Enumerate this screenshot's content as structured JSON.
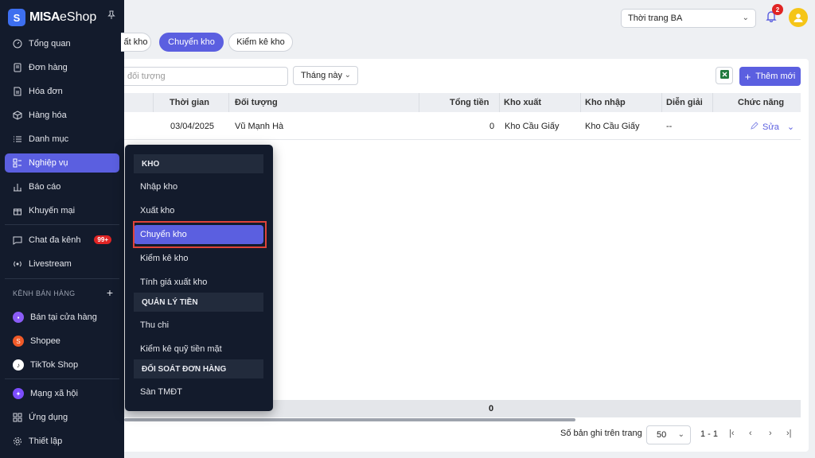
{
  "brand": {
    "logo_bold": "MISA",
    "logo_light": "eShop",
    "logo_letter": "S"
  },
  "sidebar": {
    "items": [
      {
        "label": "Tổng quan",
        "icon": "gauge-icon"
      },
      {
        "label": "Đơn hàng",
        "icon": "receipt-icon"
      },
      {
        "label": "Hóa đơn",
        "icon": "invoice-icon"
      },
      {
        "label": "Hàng hóa",
        "icon": "box-icon"
      },
      {
        "label": "Danh mục",
        "icon": "list-icon"
      },
      {
        "label": "Nghiệp vụ",
        "icon": "operations-icon",
        "active": true
      },
      {
        "label": "Báo cáo",
        "icon": "chart-icon"
      },
      {
        "label": "Khuyến mại",
        "icon": "gift-icon"
      },
      {
        "label": "Chat đa kênh",
        "icon": "chat-icon",
        "badge": "99+"
      },
      {
        "label": "Livestream",
        "icon": "broadcast-icon"
      }
    ],
    "channels_label": "KÊNH BÁN HÀNG",
    "channels": [
      {
        "label": "Bán tại cửa hàng",
        "icon": "store-icon",
        "color": "#8b5cf6"
      },
      {
        "label": "Shopee",
        "icon": "shopee-icon",
        "color": "#f05a28"
      },
      {
        "label": "TikTok Shop",
        "icon": "tiktok-icon",
        "color": "#1a1a1a"
      }
    ],
    "bottom": [
      {
        "label": "Mạng xã hội",
        "icon": "social-icon",
        "color": "#7c4dff"
      },
      {
        "label": "Ứng dụng",
        "icon": "apps-icon"
      },
      {
        "label": "Thiết lập",
        "icon": "settings-icon"
      }
    ]
  },
  "topbar": {
    "store": "Thời trang BA",
    "notification_count": "2"
  },
  "tabs": [
    "ất kho",
    "Chuyển kho",
    "Kiểm kê kho"
  ],
  "toolbar": {
    "search_placeholder": "đối tượng",
    "period": "Tháng này",
    "add_label": "Thêm mới"
  },
  "table": {
    "headers": [
      "Thời gian",
      "Đối tượng",
      "Tổng tiền",
      "Kho xuất",
      "Kho nhập",
      "Diễn giải",
      "Chức năng"
    ],
    "rows": [
      {
        "date": "03/04/2025",
        "object": "Vũ Mạnh Hà",
        "total": "0",
        "from": "Kho Cầu Giấy",
        "to": "Kho Cầu Giấy",
        "note": "--",
        "action": "Sửa"
      }
    ],
    "footer_total": "0"
  },
  "pager": {
    "label": "Số bản ghi trên trang",
    "page_size": "50",
    "range": "1 - 1"
  },
  "menu": {
    "sections": [
      {
        "title": "KHO",
        "items": [
          "Nhập kho",
          "Xuất kho",
          "Chuyển kho",
          "Kiểm kê kho",
          "Tính giá xuất kho"
        ]
      },
      {
        "title": "QUẢN LÝ TIỀN",
        "items": [
          "Thu chi",
          "Kiểm kê quỹ tiền mặt"
        ]
      },
      {
        "title": "ĐỐI SOÁT ĐƠN HÀNG",
        "items": [
          "Sàn TMĐT"
        ]
      }
    ],
    "active_item": "Chuyển kho"
  },
  "colors": {
    "accent": "#5b5fe0",
    "sidebar_bg": "#131b2c",
    "highlight": "#e0433a"
  }
}
